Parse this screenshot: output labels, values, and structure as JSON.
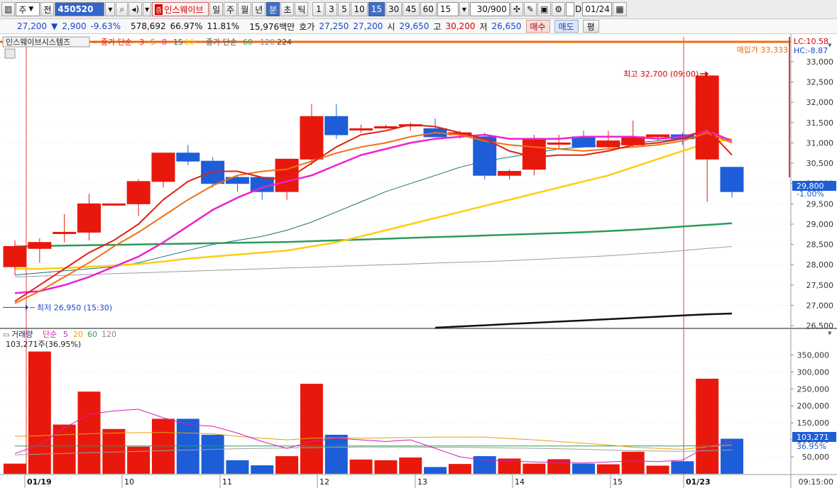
{
  "toolbar": {
    "market_type": "주",
    "prev_label": "전",
    "stock_code": "450520",
    "stock_name": "인스웨이브",
    "periods": [
      "일",
      "주",
      "월",
      "년",
      "분",
      "초",
      "틱"
    ],
    "active_period": "분",
    "intervals": [
      "1",
      "3",
      "5",
      "10",
      "15",
      "30",
      "45",
      "60"
    ],
    "active_interval": "15",
    "interval_value": "15",
    "count_display": "30/900",
    "checkbox_label": "D",
    "date_value": "01/24"
  },
  "info": {
    "price": "27,200",
    "change": "2,900",
    "change_pct": "-9.63%",
    "volume": "578,692",
    "volume_ratio": "66.97%",
    "turnover_rate": "11.81%",
    "trade_amount": "15,976백만",
    "ask_label": "호가",
    "ask_price": "27,250",
    "bid_price": "27,200",
    "open_label": "시",
    "open": "29,650",
    "high_label": "고",
    "high": "30,200",
    "low_label": "저",
    "low": "26,650",
    "buy_label": "매수",
    "sell_label": "매도",
    "eval_label": "평"
  },
  "colors": {
    "up": "#e8190c",
    "down": "#1d5ed8",
    "ma5": "#e02010",
    "ma10": "#f07010",
    "ma20": "#ee22cc",
    "ma60": "#17707a",
    "ma120": "#ffcc10",
    "ma224": "#9a9a9a",
    "ma_big": "#2e9a5a",
    "buy_price_line": "#f06a10",
    "cursor_line": "#e04040"
  },
  "price_legend": {
    "title": "인스웨이브시스템즈",
    "ma_label": "종가 단순",
    "ma_periods": [
      "3",
      "5",
      "8",
      "15",
      "20"
    ],
    "ma_label2": "종가 단순",
    "ma_periods2": [
      "60",
      "120",
      "224"
    ]
  },
  "volume_legend": {
    "title": "거래량",
    "ma_label": "단순",
    "ma_periods": [
      "5",
      "20",
      "60",
      "120"
    ],
    "current": "103,271주(36.95%)"
  },
  "side_labels": {
    "lc": "LC:10.58",
    "hc": "HC:-8.87",
    "buy_price": "매입가 33,333",
    "current_price": "29,800",
    "current_pct": "-1.00%",
    "current_volume": "103,271",
    "current_volume_pct": "36.95%"
  },
  "annotations": {
    "max_label": "최고 32,700 (09:00)",
    "min_label": "최저 26,950 (15:30)"
  },
  "time_axis": {
    "labels": [
      "01/19",
      "10",
      "11",
      "12",
      "13",
      "14",
      "15",
      "01/23"
    ],
    "clock": "09:15:00"
  },
  "chart_data": {
    "type": "candlestick",
    "price_ticks": [
      26500,
      27000,
      27500,
      28000,
      28500,
      29000,
      29500,
      30000,
      30500,
      31000,
      31500,
      32000,
      32500,
      33000
    ],
    "price_ylim": [
      26450,
      33400
    ],
    "volume_ticks": [
      50000,
      100000,
      150000,
      200000,
      250000,
      300000,
      350000
    ],
    "volume_ylim": [
      0,
      380000
    ],
    "candles": [
      {
        "o": 27950,
        "h": 28600,
        "l": 27750,
        "c": 28450,
        "v": 30000
      },
      {
        "o": 28400,
        "h": 28650,
        "l": 28050,
        "c": 28550,
        "v": 360000
      },
      {
        "o": 28800,
        "h": 29250,
        "l": 28550,
        "c": 28800,
        "v": 145000
      },
      {
        "o": 28800,
        "h": 29750,
        "l": 28600,
        "c": 29500,
        "v": 242000
      },
      {
        "o": 29500,
        "h": 29500,
        "l": 29500,
        "c": 29500,
        "v": 132000
      },
      {
        "o": 29500,
        "h": 30100,
        "l": 29200,
        "c": 30050,
        "v": 80000
      },
      {
        "o": 30050,
        "h": 30750,
        "l": 29900,
        "c": 30750,
        "v": 162000
      },
      {
        "o": 30750,
        "h": 30950,
        "l": 30450,
        "c": 30550,
        "v": 162000
      },
      {
        "o": 30550,
        "h": 30650,
        "l": 29900,
        "c": 30000,
        "v": 115000
      },
      {
        "o": 30150,
        "h": 30200,
        "l": 29800,
        "c": 30000,
        "v": 40000
      },
      {
        "o": 30150,
        "h": 30150,
        "l": 29600,
        "c": 29800,
        "v": 25000
      },
      {
        "o": 29800,
        "h": 30600,
        "l": 29600,
        "c": 30600,
        "v": 52000
      },
      {
        "o": 30600,
        "h": 31950,
        "l": 30450,
        "c": 31650,
        "v": 265000
      },
      {
        "o": 31650,
        "h": 31950,
        "l": 31100,
        "c": 31200,
        "v": 115000
      },
      {
        "o": 31350,
        "h": 31450,
        "l": 31250,
        "c": 31350,
        "v": 42000
      },
      {
        "o": 31400,
        "h": 31450,
        "l": 31350,
        "c": 31400,
        "v": 40000
      },
      {
        "o": 31450,
        "h": 31500,
        "l": 31300,
        "c": 31450,
        "v": 48000
      },
      {
        "o": 31350,
        "h": 31600,
        "l": 31250,
        "c": 31150,
        "v": 20000
      },
      {
        "o": 31200,
        "h": 31300,
        "l": 31100,
        "c": 31250,
        "v": 29000
      },
      {
        "o": 31150,
        "h": 31250,
        "l": 30100,
        "c": 30200,
        "v": 52000
      },
      {
        "o": 30200,
        "h": 30350,
        "l": 30100,
        "c": 30300,
        "v": 45000
      },
      {
        "o": 30350,
        "h": 31200,
        "l": 30200,
        "c": 31100,
        "v": 30000
      },
      {
        "o": 31000,
        "h": 31200,
        "l": 30850,
        "c": 31000,
        "v": 43000
      },
      {
        "o": 31150,
        "h": 31300,
        "l": 30900,
        "c": 30900,
        "v": 30000
      },
      {
        "o": 30900,
        "h": 31300,
        "l": 30850,
        "c": 31050,
        "v": 28000
      },
      {
        "o": 30950,
        "h": 31550,
        "l": 30900,
        "c": 31150,
        "v": 65000
      },
      {
        "o": 31150,
        "h": 31200,
        "l": 31050,
        "c": 31200,
        "v": 24000
      },
      {
        "o": 31200,
        "h": 31250,
        "l": 30950,
        "c": 31100,
        "v": 37000
      },
      {
        "o": 30600,
        "h": 32700,
        "l": 29550,
        "c": 32650,
        "v": 280000
      },
      {
        "o": 30400,
        "h": 30400,
        "l": 29650,
        "c": 29800,
        "v": 103271
      }
    ],
    "ma5": [
      27100,
      27500,
      27900,
      28300,
      28600,
      29000,
      29600,
      30050,
      30300,
      30300,
      30150,
      30100,
      30500,
      30900,
      31200,
      31300,
      31450,
      31400,
      31250,
      31100,
      30800,
      30650,
      30700,
      30700,
      30800,
      30950,
      31000,
      31100,
      31350,
      30700
    ],
    "ma10": [
      27050,
      27350,
      27700,
      28050,
      28450,
      28800,
      29200,
      29600,
      29950,
      30200,
      30300,
      30350,
      30550,
      30750,
      30900,
      31000,
      31150,
      31250,
      31200,
      31050,
      30950,
      30900,
      30850,
      30800,
      30850,
      30900,
      30950,
      31050,
      31250,
      31000
    ],
    "ma20": [
      27300,
      27350,
      27500,
      27700,
      27950,
      28200,
      28550,
      28950,
      29350,
      29650,
      29900,
      30050,
      30200,
      30450,
      30700,
      30850,
      31000,
      31100,
      31150,
      31200,
      31100,
      31100,
      31100,
      31150,
      31150,
      31150,
      31100,
      31150,
      31300,
      31050
    ],
    "ma60": [
      27750,
      27800,
      27850,
      27900,
      27950,
      28050,
      28200,
      28350,
      28500,
      28600,
      28700,
      28850,
      29050,
      29300,
      29550,
      29800,
      30000,
      30200,
      30400,
      30550,
      30650,
      30750,
      30850,
      30900,
      30950,
      31000,
      31050,
      31100,
      31150,
      31100
    ],
    "ma120": [
      27900,
      27900,
      27920,
      27950,
      27980,
      28020,
      28080,
      28150,
      28200,
      28250,
      28300,
      28350,
      28450,
      28550,
      28700,
      28850,
      29000,
      29150,
      29300,
      29450,
      29600,
      29750,
      29900,
      30050,
      30200,
      30400,
      30600,
      30800,
      31000,
      31100
    ],
    "ma224": [
      27700,
      27720,
      27740,
      27760,
      27780,
      27800,
      27820,
      27840,
      27860,
      27880,
      27900,
      27920,
      27940,
      27960,
      27980,
      28000,
      28020,
      28040,
      28060,
      28080,
      28100,
      28130,
      28160,
      28190,
      28220,
      28260,
      28300,
      28350,
      28400,
      28450
    ],
    "ma_big": [
      28450,
      28460,
      28470,
      28480,
      28490,
      28500,
      28510,
      28520,
      28530,
      28540,
      28550,
      28560,
      28580,
      28600,
      28620,
      28640,
      28660,
      28680,
      28700,
      28720,
      28740,
      28760,
      28780,
      28800,
      28830,
      28860,
      28900,
      28940,
      28980,
      29020
    ],
    "ma_black": [
      null,
      null,
      null,
      null,
      null,
      null,
      null,
      null,
      null,
      null,
      null,
      null,
      null,
      null,
      null,
      null,
      null,
      26450,
      26480,
      26510,
      26540,
      26570,
      26600,
      26630,
      26660,
      26690,
      26720,
      26750,
      26780,
      26800
    ],
    "vol_ma5": [
      60000,
      85000,
      135000,
      175000,
      185000,
      190000,
      165000,
      145000,
      140000,
      120000,
      95000,
      75000,
      95000,
      105000,
      100000,
      95000,
      100000,
      75000,
      50000,
      40000,
      38000,
      35000,
      33000,
      32000,
      35000,
      38000,
      36000,
      40000,
      80000,
      95000
    ],
    "vol_ma20": [
      110000,
      112000,
      115000,
      118000,
      120000,
      121000,
      122000,
      120000,
      118000,
      110000,
      105000,
      100000,
      105000,
      106000,
      105000,
      106000,
      107000,
      108000,
      108000,
      108000,
      104000,
      100000,
      95000,
      90000,
      85000,
      78000,
      75000,
      72000,
      80000,
      85000
    ],
    "vol_ma60": [
      82000,
      82000,
      82000,
      82000,
      82000,
      82000,
      82000,
      82000,
      82000,
      82000,
      82000,
      82000,
      82000,
      82000,
      82000,
      82000,
      82000,
      82000,
      82000,
      82000,
      82000,
      82000,
      82000,
      82000,
      82000,
      82000,
      82000,
      82000,
      83000,
      84000
    ],
    "vol_ma120": [
      56000,
      58000,
      60000,
      62000,
      64000,
      66000,
      68000,
      70000,
      72000,
      74000,
      75000,
      76000,
      77000,
      78000,
      79000,
      79000,
      79000,
      78000,
      78000,
      77000,
      76000,
      75000,
      74000,
      72000,
      70000,
      68000,
      67000,
      66000,
      68000,
      70000
    ]
  }
}
